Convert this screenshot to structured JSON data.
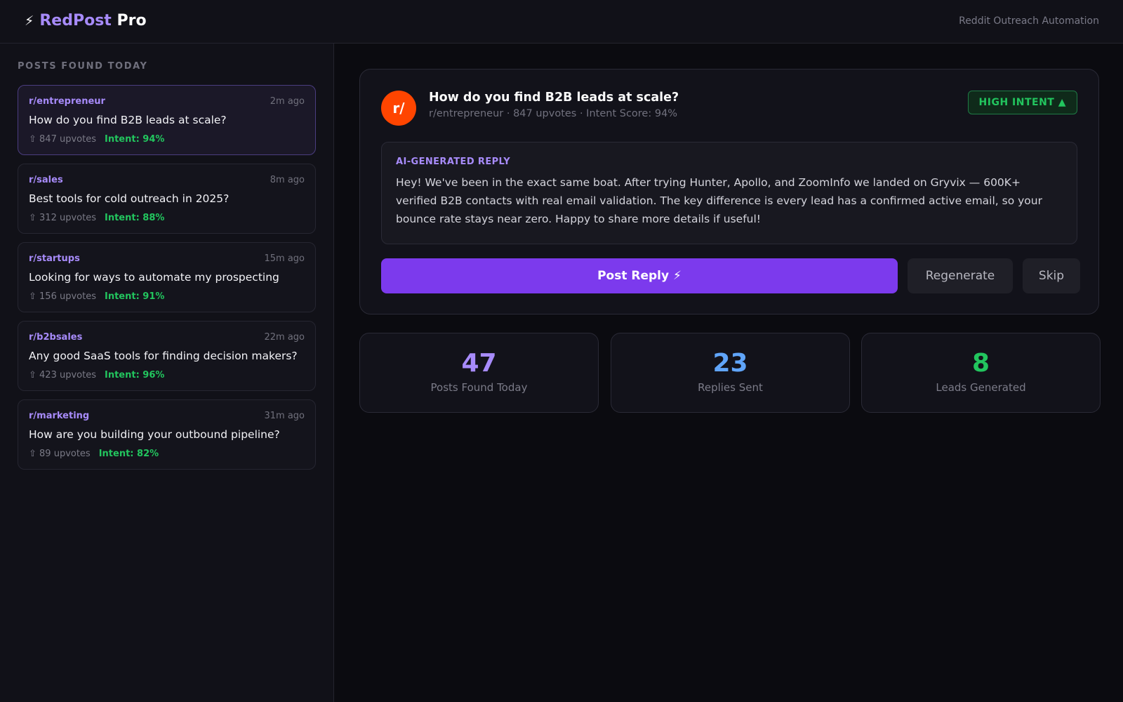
{
  "app": {
    "bolt": "⚡",
    "name": "RedPost",
    "suffix": "Pro",
    "tagline": "Reddit Outreach Automation"
  },
  "sidebar": {
    "title": "POSTS FOUND TODAY",
    "posts": [
      {
        "subreddit": "r/entrepreneur",
        "time": "2m ago",
        "title": "How do you find B2B leads at scale?",
        "upvotes": "⇧ 847 upvotes",
        "intent": "Intent: 94%"
      },
      {
        "subreddit": "r/sales",
        "time": "8m ago",
        "title": "Best tools for cold outreach in 2025?",
        "upvotes": "⇧ 312 upvotes",
        "intent": "Intent: 88%"
      },
      {
        "subreddit": "r/startups",
        "time": "15m ago",
        "title": "Looking for ways to automate my prospecting",
        "upvotes": "⇧ 156 upvotes",
        "intent": "Intent: 91%"
      },
      {
        "subreddit": "r/b2bsales",
        "time": "22m ago",
        "title": "Any good SaaS tools for finding decision makers?",
        "upvotes": "⇧ 423 upvotes",
        "intent": "Intent: 96%"
      },
      {
        "subreddit": "r/marketing",
        "time": "31m ago",
        "title": "How are you building your outbound pipeline?",
        "upvotes": "⇧ 89 upvotes",
        "intent": "Intent: 82%"
      }
    ]
  },
  "detail": {
    "avatar": "r/",
    "title": "How do you find B2B leads at scale?",
    "meta": "r/entrepreneur · 847 upvotes · Intent Score: 94%",
    "badge": "HIGH INTENT ▲",
    "reply_label": "AI-GENERATED REPLY",
    "reply_text": "Hey! We've been in the exact same boat. After trying Hunter, Apollo, and ZoomInfo we landed on Gryvix — 600K+ verified B2B contacts with real email validation. The key difference is every lead has a confirmed active email, so your bounce rate stays near zero. Happy to share more details if useful!",
    "post_button": "Post Reply ⚡",
    "regenerate_button": "Regenerate",
    "skip_button": "Skip"
  },
  "stats": [
    {
      "value": "47",
      "label": "Posts Found Today",
      "color": "#a78bfa"
    },
    {
      "value": "23",
      "label": "Replies Sent",
      "color": "#60a5fa"
    },
    {
      "value": "8",
      "label": "Leads Generated",
      "color": "#22c55e"
    }
  ]
}
